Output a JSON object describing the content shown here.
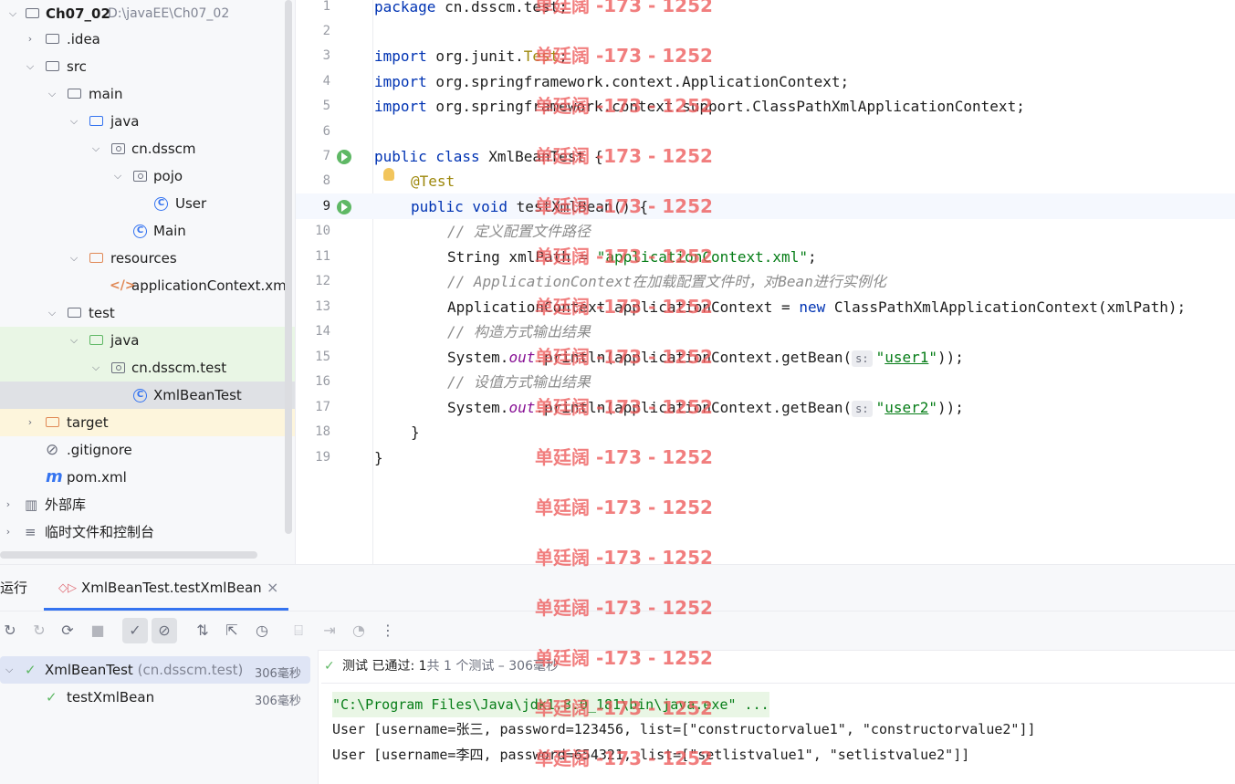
{
  "project": {
    "name": "Ch07_02",
    "path": "D:\\javaEE\\Ch07_02",
    "tree": [
      {
        "label": "Ch07_02",
        "depth": 0,
        "icon": "module-icon",
        "expanded": true
      },
      {
        "label": ".idea",
        "depth": 1,
        "icon": "folder-icon",
        "expanded": false
      },
      {
        "label": "src",
        "depth": 1,
        "icon": "folder-icon",
        "expanded": true
      },
      {
        "label": "main",
        "depth": 2,
        "icon": "folder-icon",
        "expanded": true
      },
      {
        "label": "java",
        "depth": 3,
        "icon": "source-folder-icon",
        "expanded": true
      },
      {
        "label": "cn.dsscm",
        "depth": 4,
        "icon": "package-icon",
        "expanded": true
      },
      {
        "label": "pojo",
        "depth": 5,
        "icon": "package-icon",
        "expanded": true
      },
      {
        "label": "User",
        "depth": 6,
        "icon": "class-icon"
      },
      {
        "label": "Main",
        "depth": 5,
        "icon": "class-icon"
      },
      {
        "label": "resources",
        "depth": 3,
        "icon": "resources-folder-icon",
        "expanded": true
      },
      {
        "label": "applicationContext.xml",
        "depth": 4,
        "icon": "xml-file-icon"
      },
      {
        "label": "test",
        "depth": 2,
        "icon": "folder-icon",
        "expanded": true
      },
      {
        "label": "java",
        "depth": 3,
        "icon": "test-source-folder-icon",
        "expanded": true
      },
      {
        "label": "cn.dsscm.test",
        "depth": 4,
        "icon": "package-icon",
        "expanded": true
      },
      {
        "label": "XmlBeanTest",
        "depth": 5,
        "icon": "class-icon"
      },
      {
        "label": "target",
        "depth": 1,
        "icon": "excluded-folder-icon",
        "expanded": false
      },
      {
        "label": ".gitignore",
        "depth": 1,
        "icon": "ignore-file-icon"
      },
      {
        "label": "pom.xml",
        "depth": 1,
        "icon": "maven-icon"
      },
      {
        "label": "外部库",
        "depth": 0,
        "icon": "library-icon",
        "expanded": false
      },
      {
        "label": "临时文件和控制台",
        "depth": 0,
        "icon": "scratches-icon",
        "expanded": false
      }
    ]
  },
  "editor": {
    "current_line": 9,
    "line_numbers": [
      "1",
      "2",
      "3",
      "4",
      "5",
      "6",
      "7",
      "8",
      "9",
      "10",
      "11",
      "12",
      "13",
      "14",
      "15",
      "16",
      "17",
      "18",
      "19"
    ],
    "l1_kw": "package",
    "l1_rest": " cn.dsscm.test;",
    "l3_kw": "import",
    "l3_rest": " org.junit.",
    "l3_ann": "Test",
    "l3_end": ";",
    "l4_kw": "import",
    "l4_rest": " org.springframework.context.ApplicationContext;",
    "l5_kw": "import",
    "l5_rest": " org.springframework.context.support.ClassPathXmlApplicationContext;",
    "l7_kw": "public class",
    "l7_rest": " XmlBeanTest {",
    "l8_ann": "@Test",
    "l9_kw": "public void",
    "l9_rest": " testXmlBean() {",
    "l10_cmt": "// 定义配置文件路径",
    "l11_a": "String xmlPath = ",
    "l11_str": "\"applicationContext.xml\"",
    "l11_end": ";",
    "l12_cmt": "// ApplicationContext在加载配置文件时，对Bean进行实例化",
    "l13_a": "ApplicationContext applicationContext = ",
    "l13_kw": "new",
    "l13_b": " ClassPathXmlApplicationContext(xmlPath);",
    "l14_cmt": "// 构造方式输出结果",
    "l15_a": "System.",
    "l15_out": "out",
    "l15_b": ".println(applicationContext.getBean(",
    "l15_hint": "s:",
    "l15_q1": "\"",
    "l15_str": "user1",
    "l15_q2": "\"",
    "l15_end": "));",
    "l16_cmt": "// 设值方式输出结果",
    "l17_a": "System.",
    "l17_out": "out",
    "l17_b": ".println(applicationContext.getBean(",
    "l17_hint": "s:",
    "l17_q1": "\"",
    "l17_str": "user2",
    "l17_q2": "\"",
    "l17_end": "));",
    "l18": "}",
    "l19": "}"
  },
  "run": {
    "window_label": "运行",
    "tab_label": "XmlBeanTest.testXmlBean",
    "tab_close": "×",
    "results": {
      "root_label": "XmlBeanTest",
      "root_pkg": "(cn.dsscm.test)",
      "root_time": "306毫秒",
      "child_label": "testXmlBean",
      "child_time": "306毫秒"
    },
    "status_prefix": "测试 已通过: ",
    "status_count": "1",
    "status_detail": "共 1 个测试 – 306毫秒",
    "console": [
      "\"C:\\Program Files\\Java\\jdk1.8.0_181\\bin\\java.exe\" ...",
      "User [username=张三, password=123456, list=[\"constructorvalue1\", \"constructorvalue2\"]]",
      "User [username=李四, password=654321, list=[\"setlistvalue1\", \"setlistvalue2\"]]"
    ]
  },
  "watermark": "单廷阔 -173 - 1252"
}
